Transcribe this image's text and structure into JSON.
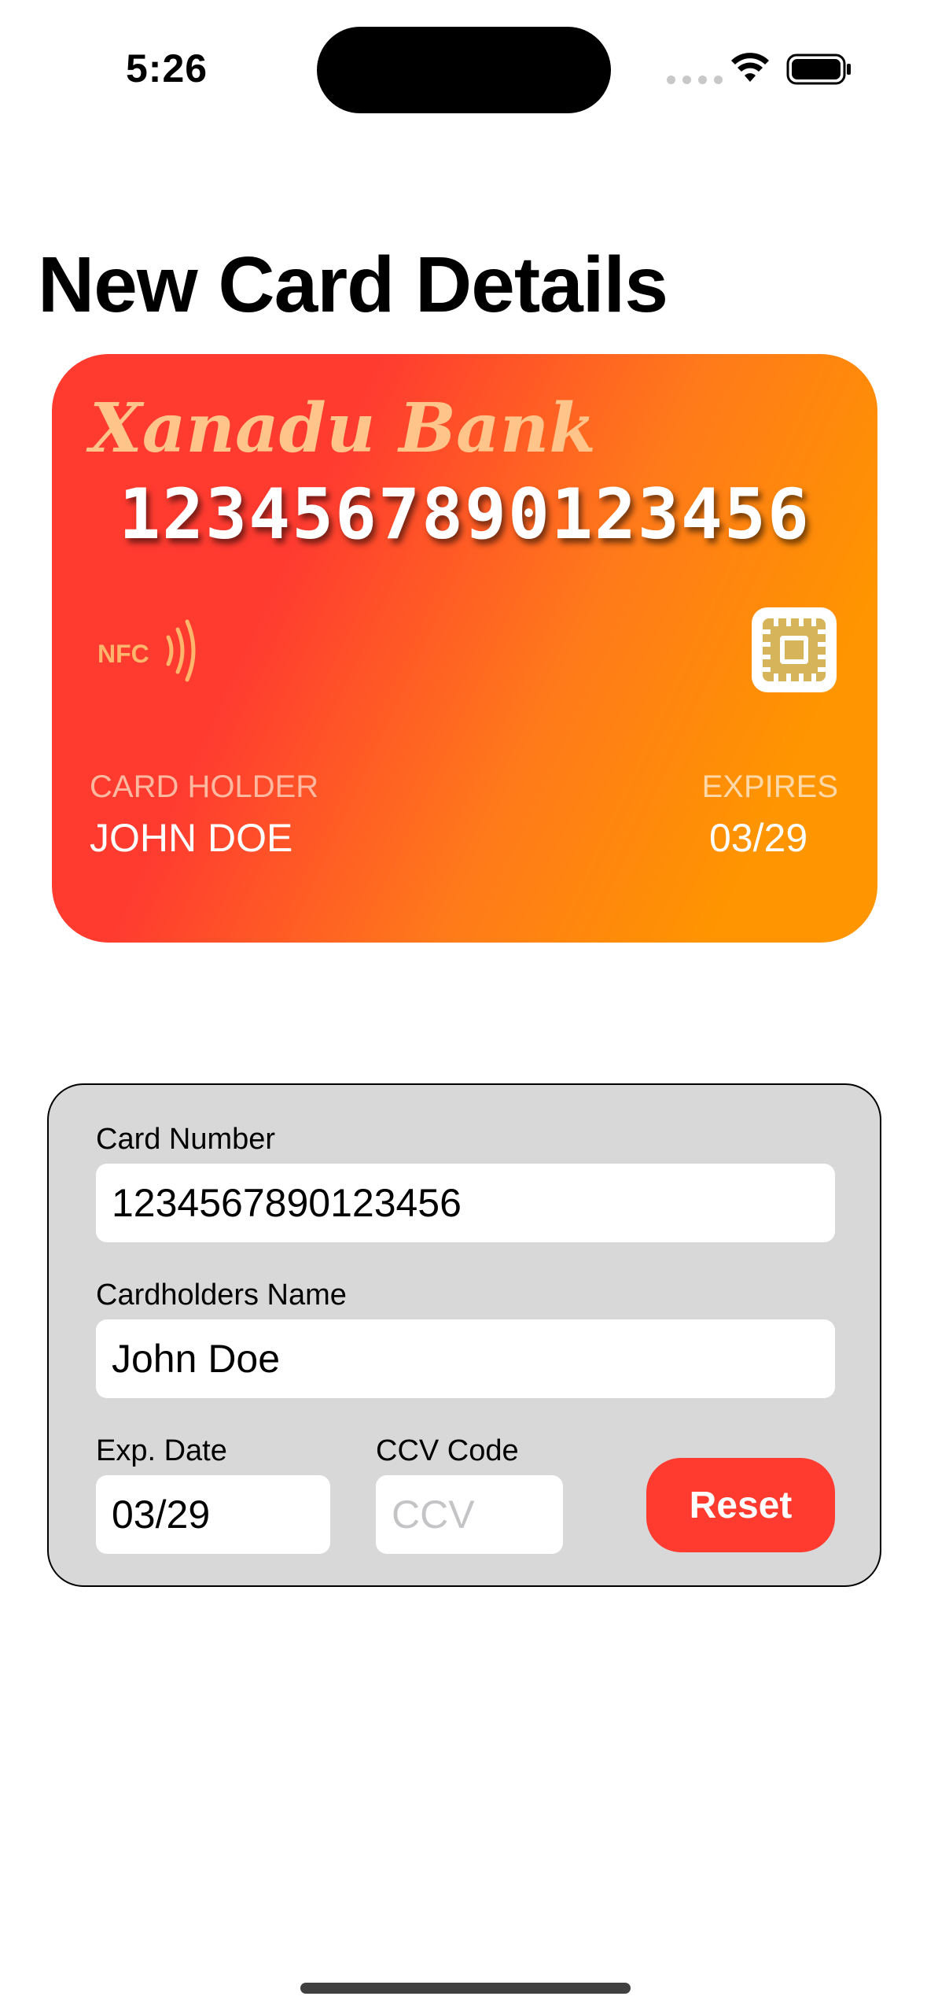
{
  "status_bar": {
    "time": "5:26"
  },
  "page": {
    "title": "New Card Details"
  },
  "card": {
    "bank_name": "Xanadu Bank",
    "number": "1234567890123456",
    "nfc_label": "NFC",
    "holder_caption": "CARD HOLDER",
    "holder_name": "JOHN DOE",
    "expires_caption": "EXPIRES",
    "expires_value": "03/29",
    "gradient_start_color": "#ff3b30",
    "gradient_end_color": "#ff9500",
    "chip_color": "#d6b45a"
  },
  "form": {
    "card_number": {
      "label": "Card Number",
      "value": "1234567890123456"
    },
    "cardholder_name": {
      "label": "Cardholders Name",
      "value": "John Doe"
    },
    "exp_date": {
      "label": "Exp. Date",
      "value": "03/29"
    },
    "ccv": {
      "label": "CCV Code",
      "placeholder": "CCV"
    },
    "reset_label": "Reset",
    "reset_color": "#ff3b30"
  }
}
